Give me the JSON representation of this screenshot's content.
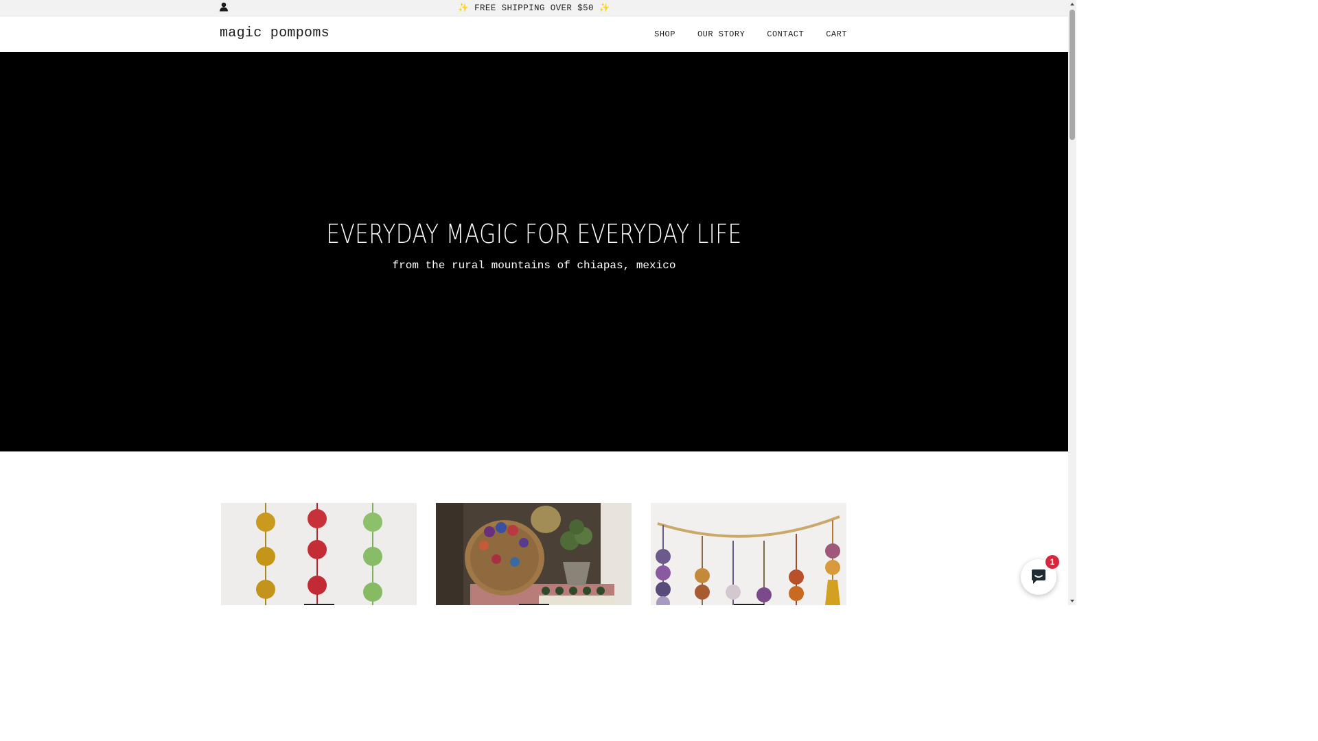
{
  "announcement": {
    "text": "✨ FREE SHIPPING OVER $50 ✨"
  },
  "header": {
    "logo": "magic pompoms",
    "nav": [
      {
        "label": "SHOP"
      },
      {
        "label": "OUR STORY"
      },
      {
        "label": "CONTACT"
      },
      {
        "label": "CART"
      }
    ]
  },
  "hero": {
    "title": "EVERYDAY MAGIC FOR EVERYDAY LIFE",
    "subtitle": "from the rural mountains of chiapas, mexico",
    "background_color": "#000000"
  },
  "products": [
    {
      "image": "pompom-strands-photo"
    },
    {
      "image": "woven-basket-with-pompoms-photo"
    },
    {
      "image": "pompom-garland-photo"
    }
  ],
  "chat": {
    "badge_count": "1",
    "icon": "chat-bubble-icon",
    "accent_color": "#d9263c"
  },
  "icons": {
    "account": "user-icon"
  }
}
